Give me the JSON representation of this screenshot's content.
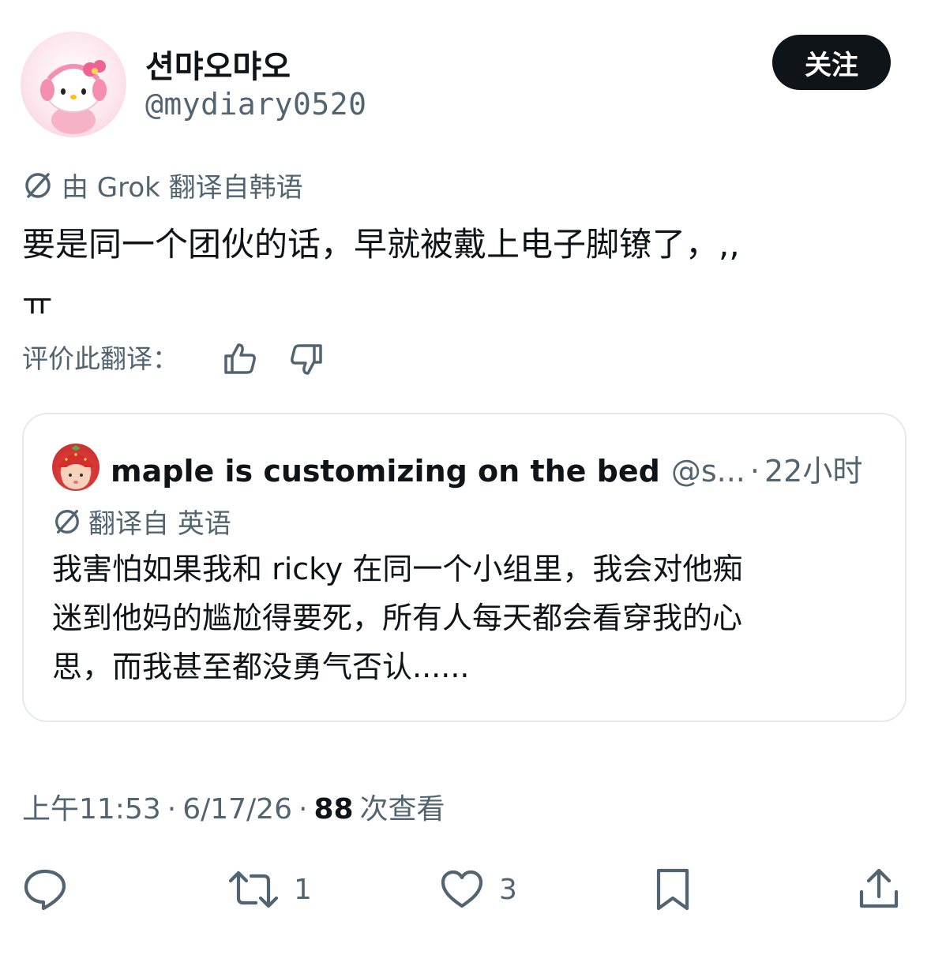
{
  "author": {
    "display_name": "션먀오먀오",
    "handle": "@mydiary0520"
  },
  "follow_label": "关注",
  "translation": {
    "note": "由 Grok 翻译自韩语",
    "text_line1": "要是同一个团伙的话，早就被戴上电子脚镣了，,,",
    "text_line2": "ㅠ",
    "rate_label": "评价此翻译："
  },
  "quote": {
    "name": "maple is customizing on the bed",
    "handle": "@s...",
    "separator": "·",
    "time": "22小时",
    "translation_note": "翻译自 英语",
    "text_lines": [
      "我害怕如果我和 ricky 在同一个小组里，我会对他痴",
      "迷到他妈的尴尬得要死，所有人每天都会看穿我的心",
      "思，而我甚至都没勇气否认......"
    ]
  },
  "meta": {
    "time": "上午11:53",
    "date": "6/17/26",
    "sep": "·",
    "views_count": "88",
    "views_label": "次查看"
  },
  "actions": {
    "retweet_count": "1",
    "like_count": "3"
  }
}
